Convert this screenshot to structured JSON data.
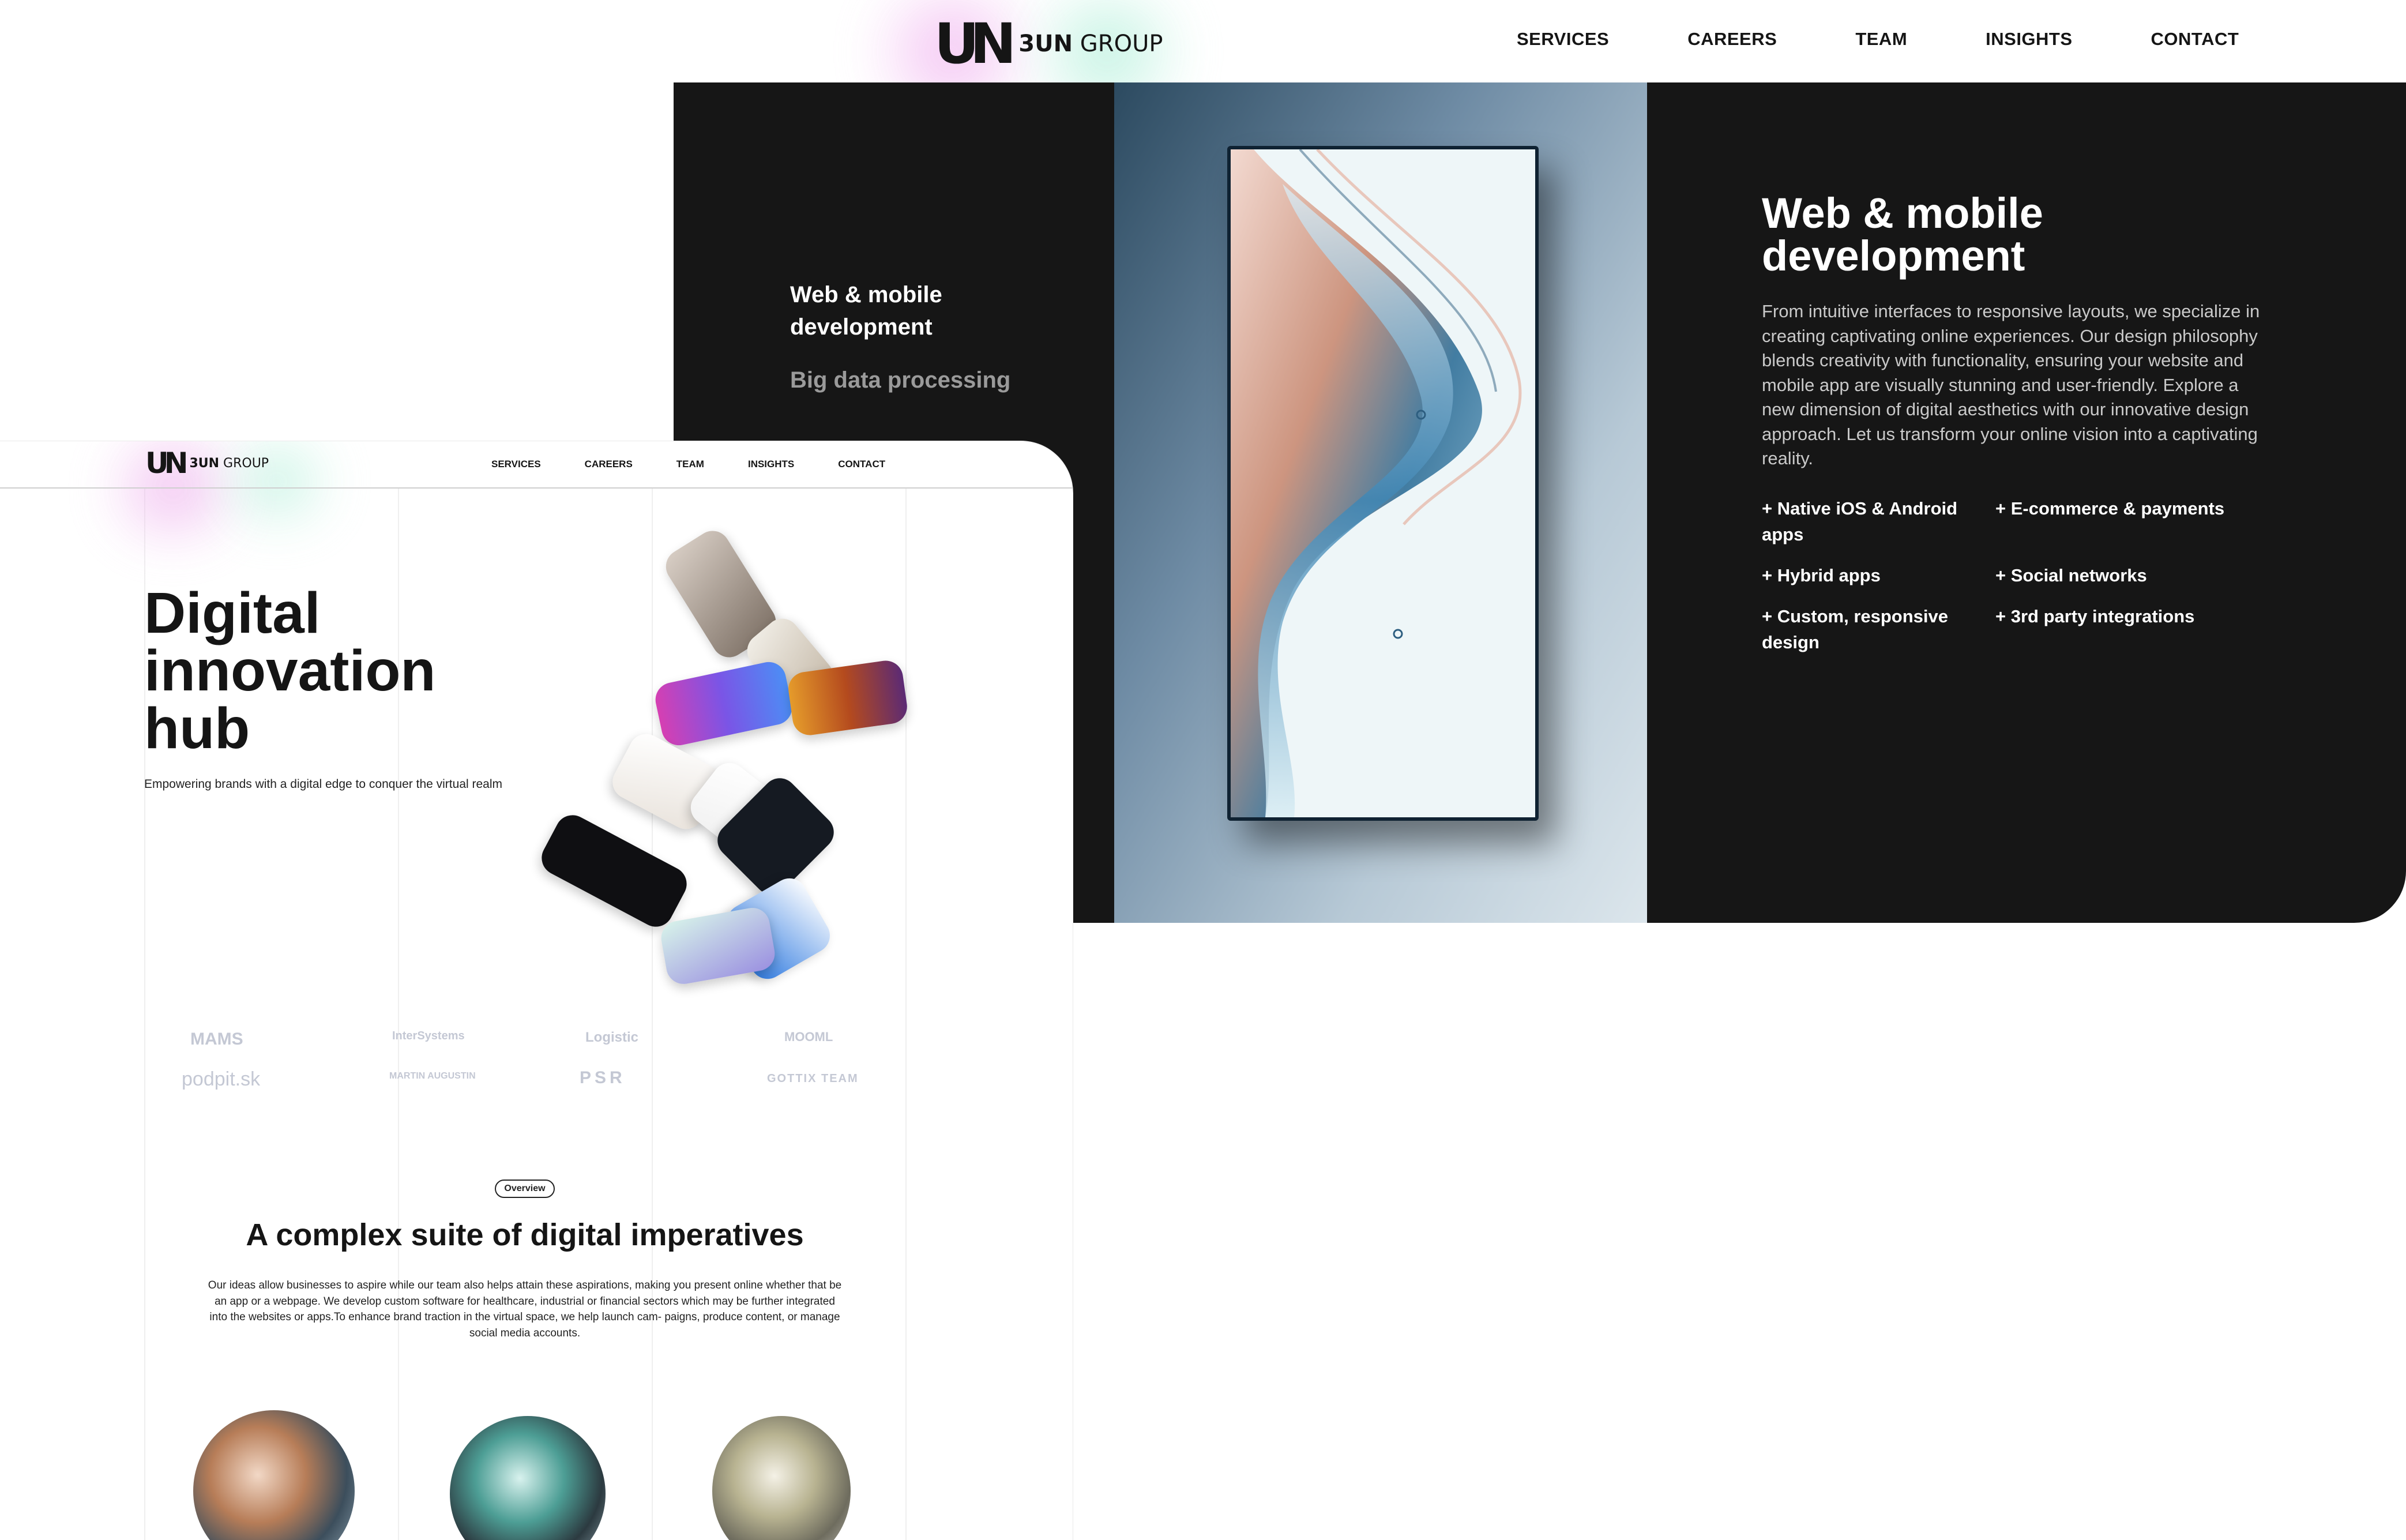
{
  "brand": {
    "mark": "UN",
    "name_bold": "3UN",
    "name_rest": " GROUP"
  },
  "desktop": {
    "nav": [
      "SERVICES",
      "CAREERS",
      "TEAM",
      "INSIGHTS",
      "CONTACT"
    ],
    "service_menu": {
      "active": "Web & mobile development",
      "next": "Big data processing"
    },
    "detail": {
      "title": "Web & mobile development",
      "body": "From intuitive interfaces to responsive layouts, we specialize in creating captivating online experiences. Our design philosophy blends creativity with functionality, ensuring your website and mobile app are visually stunning and user-friendly. Explore a new dimension of digital aesthetics with our innovative design approach. Let us transform your online vision into a captivating reality.",
      "features": [
        "+ Native iOS & Android apps",
        "+ E-commerce & payments",
        "+ Hybrid apps",
        "+ Social networks",
        "+ Custom, responsive design",
        "+ 3rd party integrations"
      ]
    }
  },
  "overlay": {
    "nav": [
      "SERVICES",
      "CAREERS",
      "TEAM",
      "INSIGHTS",
      "CONTACT"
    ],
    "hero": {
      "title": "Digital innovation hub",
      "subtitle": "Empowering brands with a digital edge to conquer the virtual realm"
    },
    "clients": [
      "MAMS",
      "InterSystems",
      "Logistic",
      "MOOML",
      "podpit.sk",
      "MARTIN AUGUSTIN",
      "PSR",
      "GOTTIX TEAM"
    ],
    "overview": {
      "pill": "Overview",
      "title": "A complex suite of digital imperatives",
      "body": "Our ideas allow businesses to aspire while our team also helps attain these aspirations, making you present online whether that be an app or a webpage. We develop custom software for healthcare, industrial or financial sectors which may be further integrated into the websites or apps.To enhance brand traction in the virtual space, we help launch cam- paigns, produce content, or manage social media accounts."
    }
  }
}
